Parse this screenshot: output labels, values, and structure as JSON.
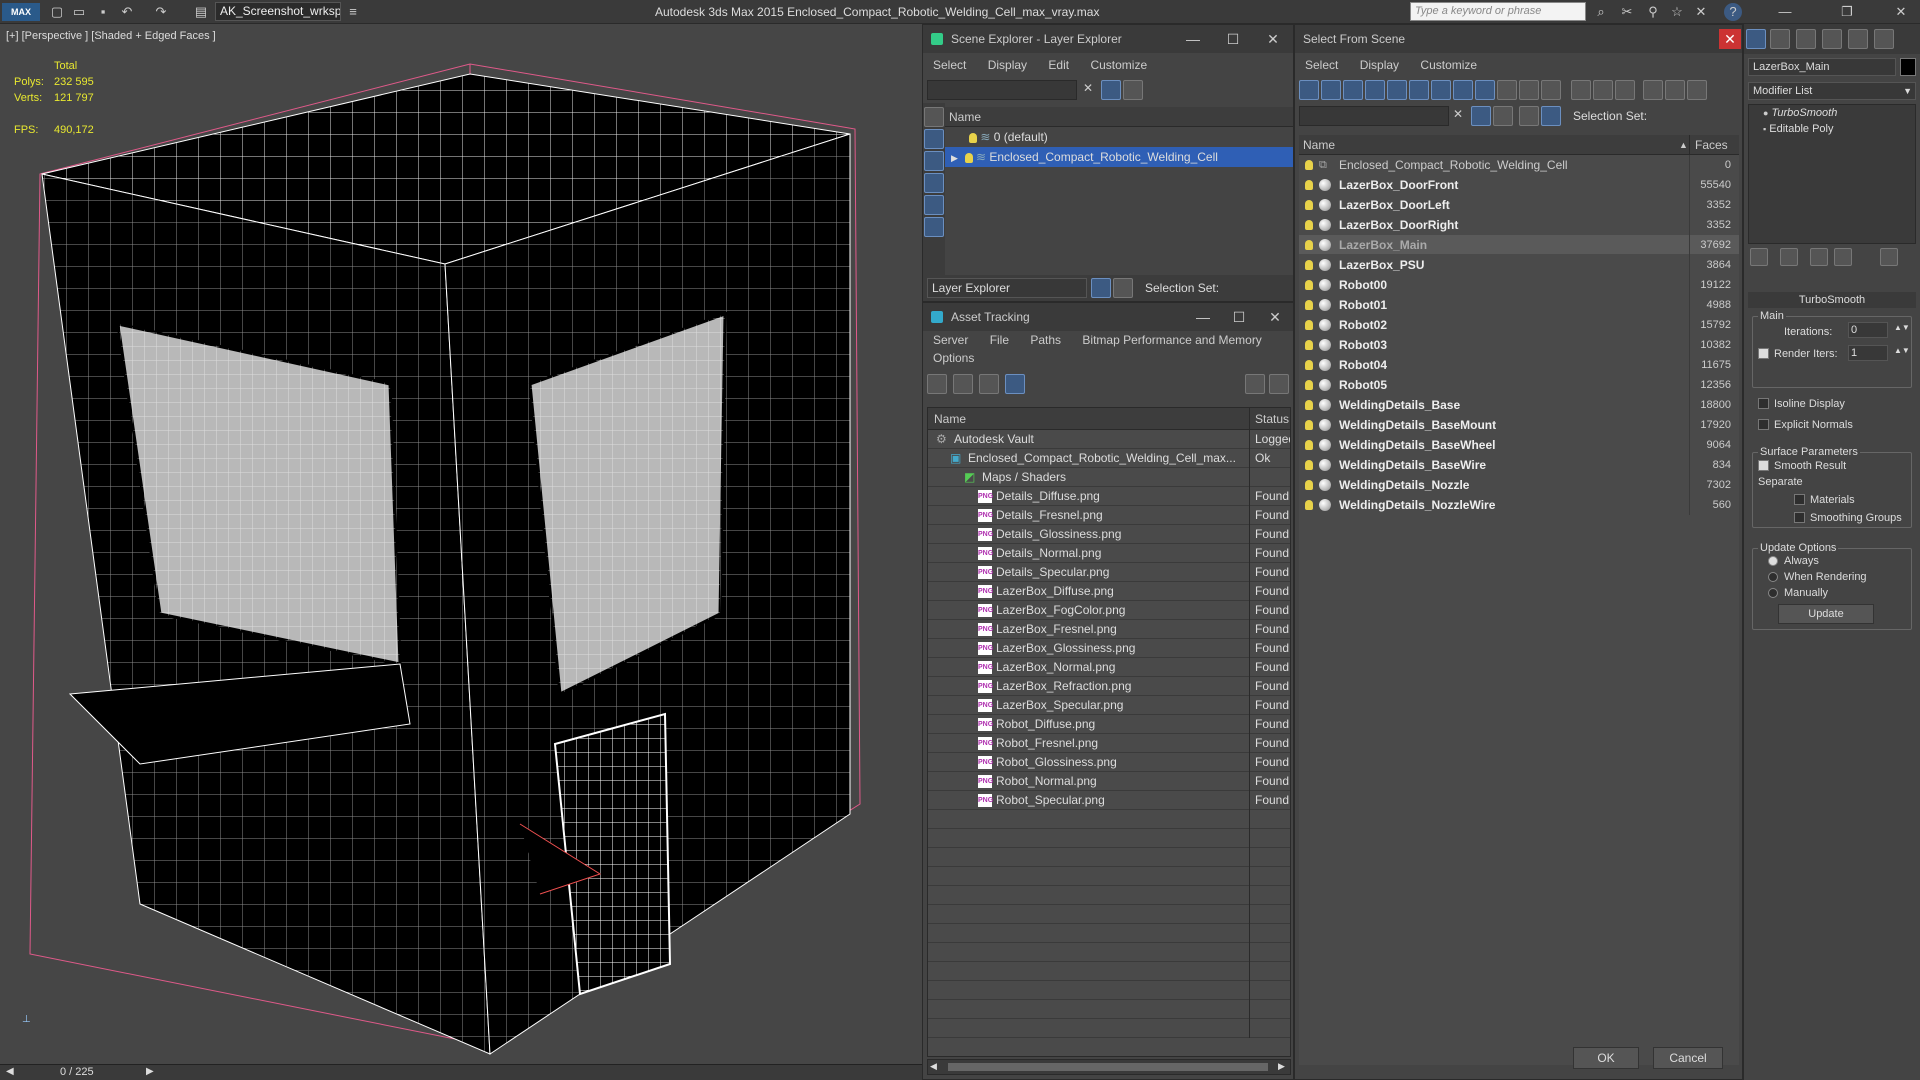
{
  "app": {
    "title": "Autodesk 3ds Max  2015    Enclosed_Compact_Robotic_Welding_Cell_max_vray.max",
    "logo": "MAX",
    "workspace": "AK_Screenshot_wrksp",
    "search_placeholder": "Type a keyword or phrase"
  },
  "viewport": {
    "label": "[+] [Perspective ] [Shaded + Edged Faces ]",
    "stats": [
      {
        "key": "",
        "value": "Total"
      },
      {
        "key": "Polys:",
        "value": "232 595"
      },
      {
        "key": "Verts:",
        "value": "121 797"
      },
      {
        "key": "FPS:",
        "value": "490,172"
      }
    ],
    "timeline": "0 / 225"
  },
  "scene_explorer": {
    "title": "Scene Explorer - Layer Explorer",
    "menu": [
      "Select",
      "Display",
      "Edit",
      "Customize"
    ],
    "column": "Name",
    "layers": [
      {
        "name": "0 (default)",
        "selected": false
      },
      {
        "name": "Enclosed_Compact_Robotic_Welding_Cell",
        "selected": true
      }
    ],
    "footer_dropdown": "Layer Explorer",
    "selection_set_label": "Selection Set:"
  },
  "asset_tracking": {
    "title": "Asset Tracking",
    "menu": [
      "Server",
      "File",
      "Paths",
      "Bitmap Performance and Memory"
    ],
    "menu2": "Options",
    "columns": {
      "name": "Name",
      "status": "Status"
    },
    "rows": [
      {
        "name": "Autodesk Vault",
        "status": "Logged",
        "indent": 1,
        "icon": "vault"
      },
      {
        "name": "Enclosed_Compact_Robotic_Welding_Cell_max...",
        "status": "Ok",
        "indent": 2,
        "icon": "max"
      },
      {
        "name": "Maps / Shaders",
        "status": "",
        "indent": 3,
        "icon": "maps"
      },
      {
        "name": "Details_Diffuse.png",
        "status": "Found",
        "indent": 4,
        "icon": "png"
      },
      {
        "name": "Details_Fresnel.png",
        "status": "Found",
        "indent": 4,
        "icon": "png"
      },
      {
        "name": "Details_Glossiness.png",
        "status": "Found",
        "indent": 4,
        "icon": "png"
      },
      {
        "name": "Details_Normal.png",
        "status": "Found",
        "indent": 4,
        "icon": "png"
      },
      {
        "name": "Details_Specular.png",
        "status": "Found",
        "indent": 4,
        "icon": "png"
      },
      {
        "name": "LazerBox_Diffuse.png",
        "status": "Found",
        "indent": 4,
        "icon": "png"
      },
      {
        "name": "LazerBox_FogColor.png",
        "status": "Found",
        "indent": 4,
        "icon": "png"
      },
      {
        "name": "LazerBox_Fresnel.png",
        "status": "Found",
        "indent": 4,
        "icon": "png"
      },
      {
        "name": "LazerBox_Glossiness.png",
        "status": "Found",
        "indent": 4,
        "icon": "png"
      },
      {
        "name": "LazerBox_Normal.png",
        "status": "Found",
        "indent": 4,
        "icon": "png"
      },
      {
        "name": "LazerBox_Refraction.png",
        "status": "Found",
        "indent": 4,
        "icon": "png"
      },
      {
        "name": "LazerBox_Specular.png",
        "status": "Found",
        "indent": 4,
        "icon": "png"
      },
      {
        "name": "Robot_Diffuse.png",
        "status": "Found",
        "indent": 4,
        "icon": "png"
      },
      {
        "name": "Robot_Fresnel.png",
        "status": "Found",
        "indent": 4,
        "icon": "png"
      },
      {
        "name": "Robot_Glossiness.png",
        "status": "Found",
        "indent": 4,
        "icon": "png"
      },
      {
        "name": "Robot_Normal.png",
        "status": "Found",
        "indent": 4,
        "icon": "png"
      },
      {
        "name": "Robot_Specular.png",
        "status": "Found",
        "indent": 4,
        "icon": "png"
      }
    ]
  },
  "select_from_scene": {
    "title": "Select From Scene",
    "menu": [
      "Select",
      "Display",
      "Customize"
    ],
    "selection_set_label": "Selection Set:",
    "columns": {
      "name": "Name",
      "faces": "Faces"
    },
    "rows": [
      {
        "name": "Enclosed_Compact_Robotic_Welding_Cell",
        "faces": "0",
        "type": "group"
      },
      {
        "name": "LazerBox_DoorFront",
        "faces": "55540"
      },
      {
        "name": "LazerBox_DoorLeft",
        "faces": "3352"
      },
      {
        "name": "LazerBox_DoorRight",
        "faces": "3352"
      },
      {
        "name": "LazerBox_Main",
        "faces": "37692",
        "selected": true
      },
      {
        "name": "LazerBox_PSU",
        "faces": "3864"
      },
      {
        "name": "Robot00",
        "faces": "19122"
      },
      {
        "name": "Robot01",
        "faces": "4988"
      },
      {
        "name": "Robot02",
        "faces": "15792"
      },
      {
        "name": "Robot03",
        "faces": "10382"
      },
      {
        "name": "Robot04",
        "faces": "11675"
      },
      {
        "name": "Robot05",
        "faces": "12356"
      },
      {
        "name": "WeldingDetails_Base",
        "faces": "18800"
      },
      {
        "name": "WeldingDetails_BaseMount",
        "faces": "17920"
      },
      {
        "name": "WeldingDetails_BaseWheel",
        "faces": "9064"
      },
      {
        "name": "WeldingDetails_BaseWire",
        "faces": "834"
      },
      {
        "name": "WeldingDetails_Nozzle",
        "faces": "7302"
      },
      {
        "name": "WeldingDetails_NozzleWire",
        "faces": "560"
      }
    ],
    "ok": "OK",
    "cancel": "Cancel"
  },
  "command_panel": {
    "object_name": "LazerBox_Main",
    "modifier_list": "Modifier List",
    "stack": [
      "TurboSmooth",
      "Editable Poly"
    ],
    "rollout": "TurboSmooth",
    "main_group": "Main",
    "iterations_label": "Iterations:",
    "iterations": "0",
    "render_iters_label": "Render Iters:",
    "render_iters": "1",
    "isoline": "Isoline Display",
    "explicit_normals": "Explicit Normals",
    "surface_group": "Surface Parameters",
    "smooth_result": "Smooth Result",
    "separate": "Separate",
    "materials": "Materials",
    "smoothing_groups": "Smoothing Groups",
    "update_group": "Update Options",
    "always": "Always",
    "when_rendering": "When Rendering",
    "manually": "Manually",
    "update_button": "Update"
  },
  "colors": {
    "selection": "#2f5fb5",
    "stats": "#e8e830",
    "accent": "#6b8fc0"
  }
}
